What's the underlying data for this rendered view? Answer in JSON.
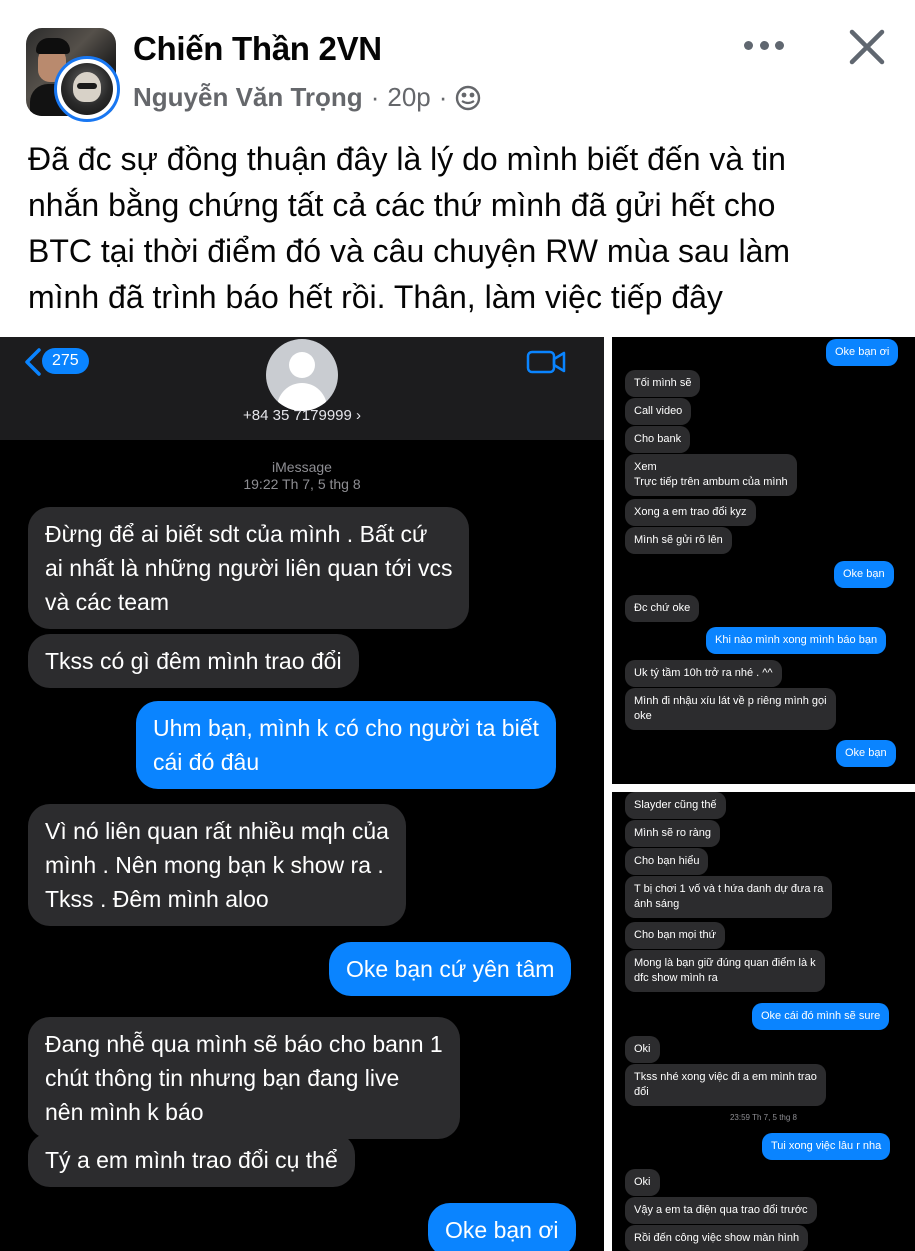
{
  "post": {
    "group_name": "Chiến Thần 2VN",
    "author": "Nguyễn Văn Trọng",
    "separator": "·",
    "time": "20p",
    "text_lines": [
      "Đã đc sự đồng thuận đây là lý do mình biết đến và tin",
      "nhắn bằng chứng tất cả các thứ mình đã gửi hết cho",
      "BTC tại thời điểm đó và câu chuyện RW mùa sau làm",
      "mình đã trình báo hết rồi. Thân, làm việc tiếp đây"
    ],
    "icons": {
      "privacy": "globe-icon",
      "more": "more-options-icon",
      "close": "close-icon"
    }
  },
  "imessage": {
    "back_count": "275",
    "contact_number": "+84 35 7179999 ›",
    "service_label": "iMessage",
    "timestamp": "19:22 Th 7, 5 thg 8",
    "messages": [
      {
        "dir": "in",
        "lines": [
          "Đừng để ai biết sdt của mình . Bất cứ",
          "ai nhất là những người liên quan tới vcs",
          "và các team"
        ]
      },
      {
        "dir": "in",
        "lines": [
          "Tkss có gì đêm mình trao đổi"
        ]
      },
      {
        "dir": "out",
        "lines": [
          "Uhm bạn, mình k có cho người ta biết",
          "cái đó đâu"
        ]
      },
      {
        "dir": "in",
        "lines": [
          "Vì nó liên quan rất nhiều mqh của",
          "mình . Nên mong bạn k show ra .",
          "Tkss . Đêm mình aloo"
        ]
      },
      {
        "dir": "out",
        "lines": [
          "Oke bạn cứ yên tâm"
        ]
      },
      {
        "dir": "in",
        "lines": [
          "Đang nhễ qua mình sẽ báo cho bann 1",
          "chút thông tin nhưng bạn đang live",
          "nên mình k báo"
        ]
      },
      {
        "dir": "in",
        "lines": [
          "Tý a em mình trao đổi cụ thể"
        ]
      },
      {
        "dir": "out",
        "lines": [
          "Oke bạn ơi"
        ]
      }
    ]
  },
  "chat_top": {
    "messages": [
      {
        "dir": "out",
        "lines": [
          "Oke bạn ơi"
        ]
      },
      {
        "dir": "in",
        "lines": [
          "Tối mình sẽ"
        ]
      },
      {
        "dir": "in",
        "lines": [
          "Call video"
        ]
      },
      {
        "dir": "in",
        "lines": [
          "Cho bank"
        ]
      },
      {
        "dir": "in",
        "lines": [
          "Xem",
          "Trực tiếp trên ambum của mình"
        ]
      },
      {
        "dir": "in",
        "lines": [
          "Xong a em trao đổi kyz"
        ]
      },
      {
        "dir": "in",
        "lines": [
          "Mình sẽ gửi rõ lên"
        ]
      },
      {
        "dir": "out",
        "lines": [
          "Oke bạn"
        ]
      },
      {
        "dir": "in",
        "lines": [
          "Đc chứ oke"
        ]
      },
      {
        "dir": "out",
        "lines": [
          "Khi nào mình xong mình báo bạn"
        ]
      },
      {
        "dir": "in",
        "lines": [
          "Uk tý tầm 10h trở ra nhé . ^^"
        ]
      },
      {
        "dir": "in",
        "lines": [
          "Mình đi nhậu xíu lát về p riêng mình gọi",
          "oke"
        ]
      },
      {
        "dir": "out",
        "lines": [
          "Oke bạn"
        ]
      }
    ]
  },
  "chat_bottom": {
    "timestamp": "23:59 Th 7, 5 thg 8",
    "messages": [
      {
        "dir": "in",
        "lines": [
          "Slayder cũng thế"
        ]
      },
      {
        "dir": "in",
        "lines": [
          "Mình sẽ ro ràng"
        ]
      },
      {
        "dir": "in",
        "lines": [
          "Cho bạn hiểu"
        ]
      },
      {
        "dir": "in",
        "lines": [
          "T bị chơi 1 vố và t hứa danh dự đưa ra",
          "ánh sáng"
        ]
      },
      {
        "dir": "in",
        "lines": [
          "Cho bạn mọi thứ"
        ]
      },
      {
        "dir": "in",
        "lines": [
          "Mong là bạn giữ đúng quan điểm là k",
          "dfc show mình ra"
        ]
      },
      {
        "dir": "out",
        "lines": [
          "Oke cái đó mình sẽ sure"
        ]
      },
      {
        "dir": "in",
        "lines": [
          "Oki"
        ]
      },
      {
        "dir": "in",
        "lines": [
          "Tkss nhé xong việc đi a em mình trao",
          "đổi"
        ]
      },
      {
        "dir": "out",
        "lines": [
          "Tui xong việc lâu r nha"
        ]
      },
      {
        "dir": "in",
        "lines": [
          "Oki"
        ]
      },
      {
        "dir": "in",
        "lines": [
          "Vậy a em ta điện qua trao đổi trước"
        ]
      },
      {
        "dir": "in",
        "lines": [
          "Rồi đến công việc show màn hình"
        ]
      }
    ]
  }
}
